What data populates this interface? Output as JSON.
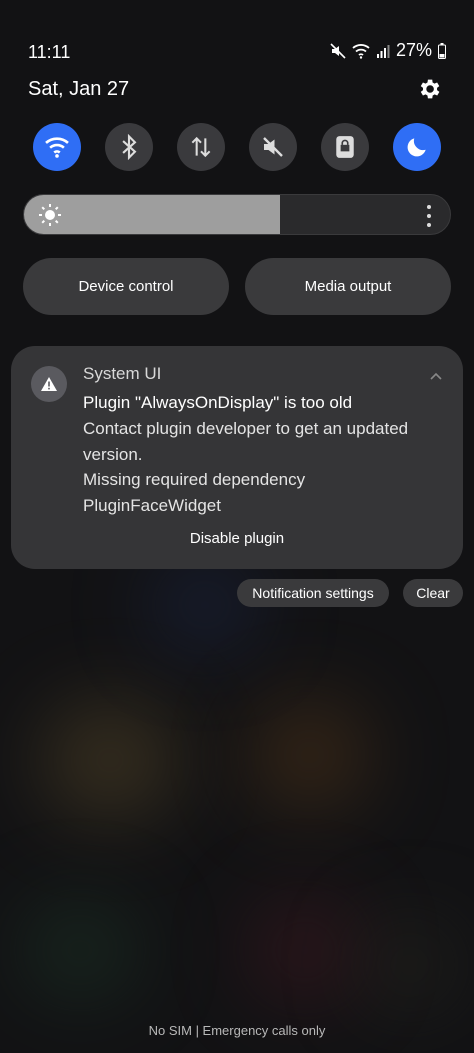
{
  "status_bar": {
    "time": "11:11",
    "battery": "27%",
    "icons": [
      "mute-icon",
      "wifi-icon",
      "signal-icon",
      "battery-icon"
    ]
  },
  "header": {
    "date": "Sat, Jan 27",
    "settings_icon": "gear-icon"
  },
  "quick_settings": [
    {
      "name": "wifi-toggle",
      "icon": "wifi-icon",
      "on": true
    },
    {
      "name": "bluetooth-toggle",
      "icon": "bluetooth-icon",
      "on": false
    },
    {
      "name": "mobile-data-toggle",
      "icon": "data-arrows-icon",
      "on": false
    },
    {
      "name": "sound-toggle",
      "icon": "mute-icon",
      "on": false
    },
    {
      "name": "lock-toggle",
      "icon": "lock-icon",
      "on": false
    },
    {
      "name": "dark-mode-toggle",
      "icon": "moon-icon",
      "on": true
    }
  ],
  "brightness": {
    "level": 0.6
  },
  "pills": {
    "device_control": "Device control",
    "media_output": "Media output"
  },
  "notification": {
    "app": "System UI",
    "title": "Plugin \"AlwaysOnDisplay\" is too old",
    "body_lines": [
      "Contact plugin developer to get an updated",
      "version.",
      "Missing required dependency",
      "PluginFaceWidget"
    ],
    "action": "Disable plugin"
  },
  "notification_buttons": {
    "settings": "Notification settings",
    "clear": "Clear"
  },
  "footer": "No SIM | Emergency calls only",
  "colors": {
    "accent": "#2f6ef5",
    "background": "#121214",
    "card": "#353537"
  }
}
